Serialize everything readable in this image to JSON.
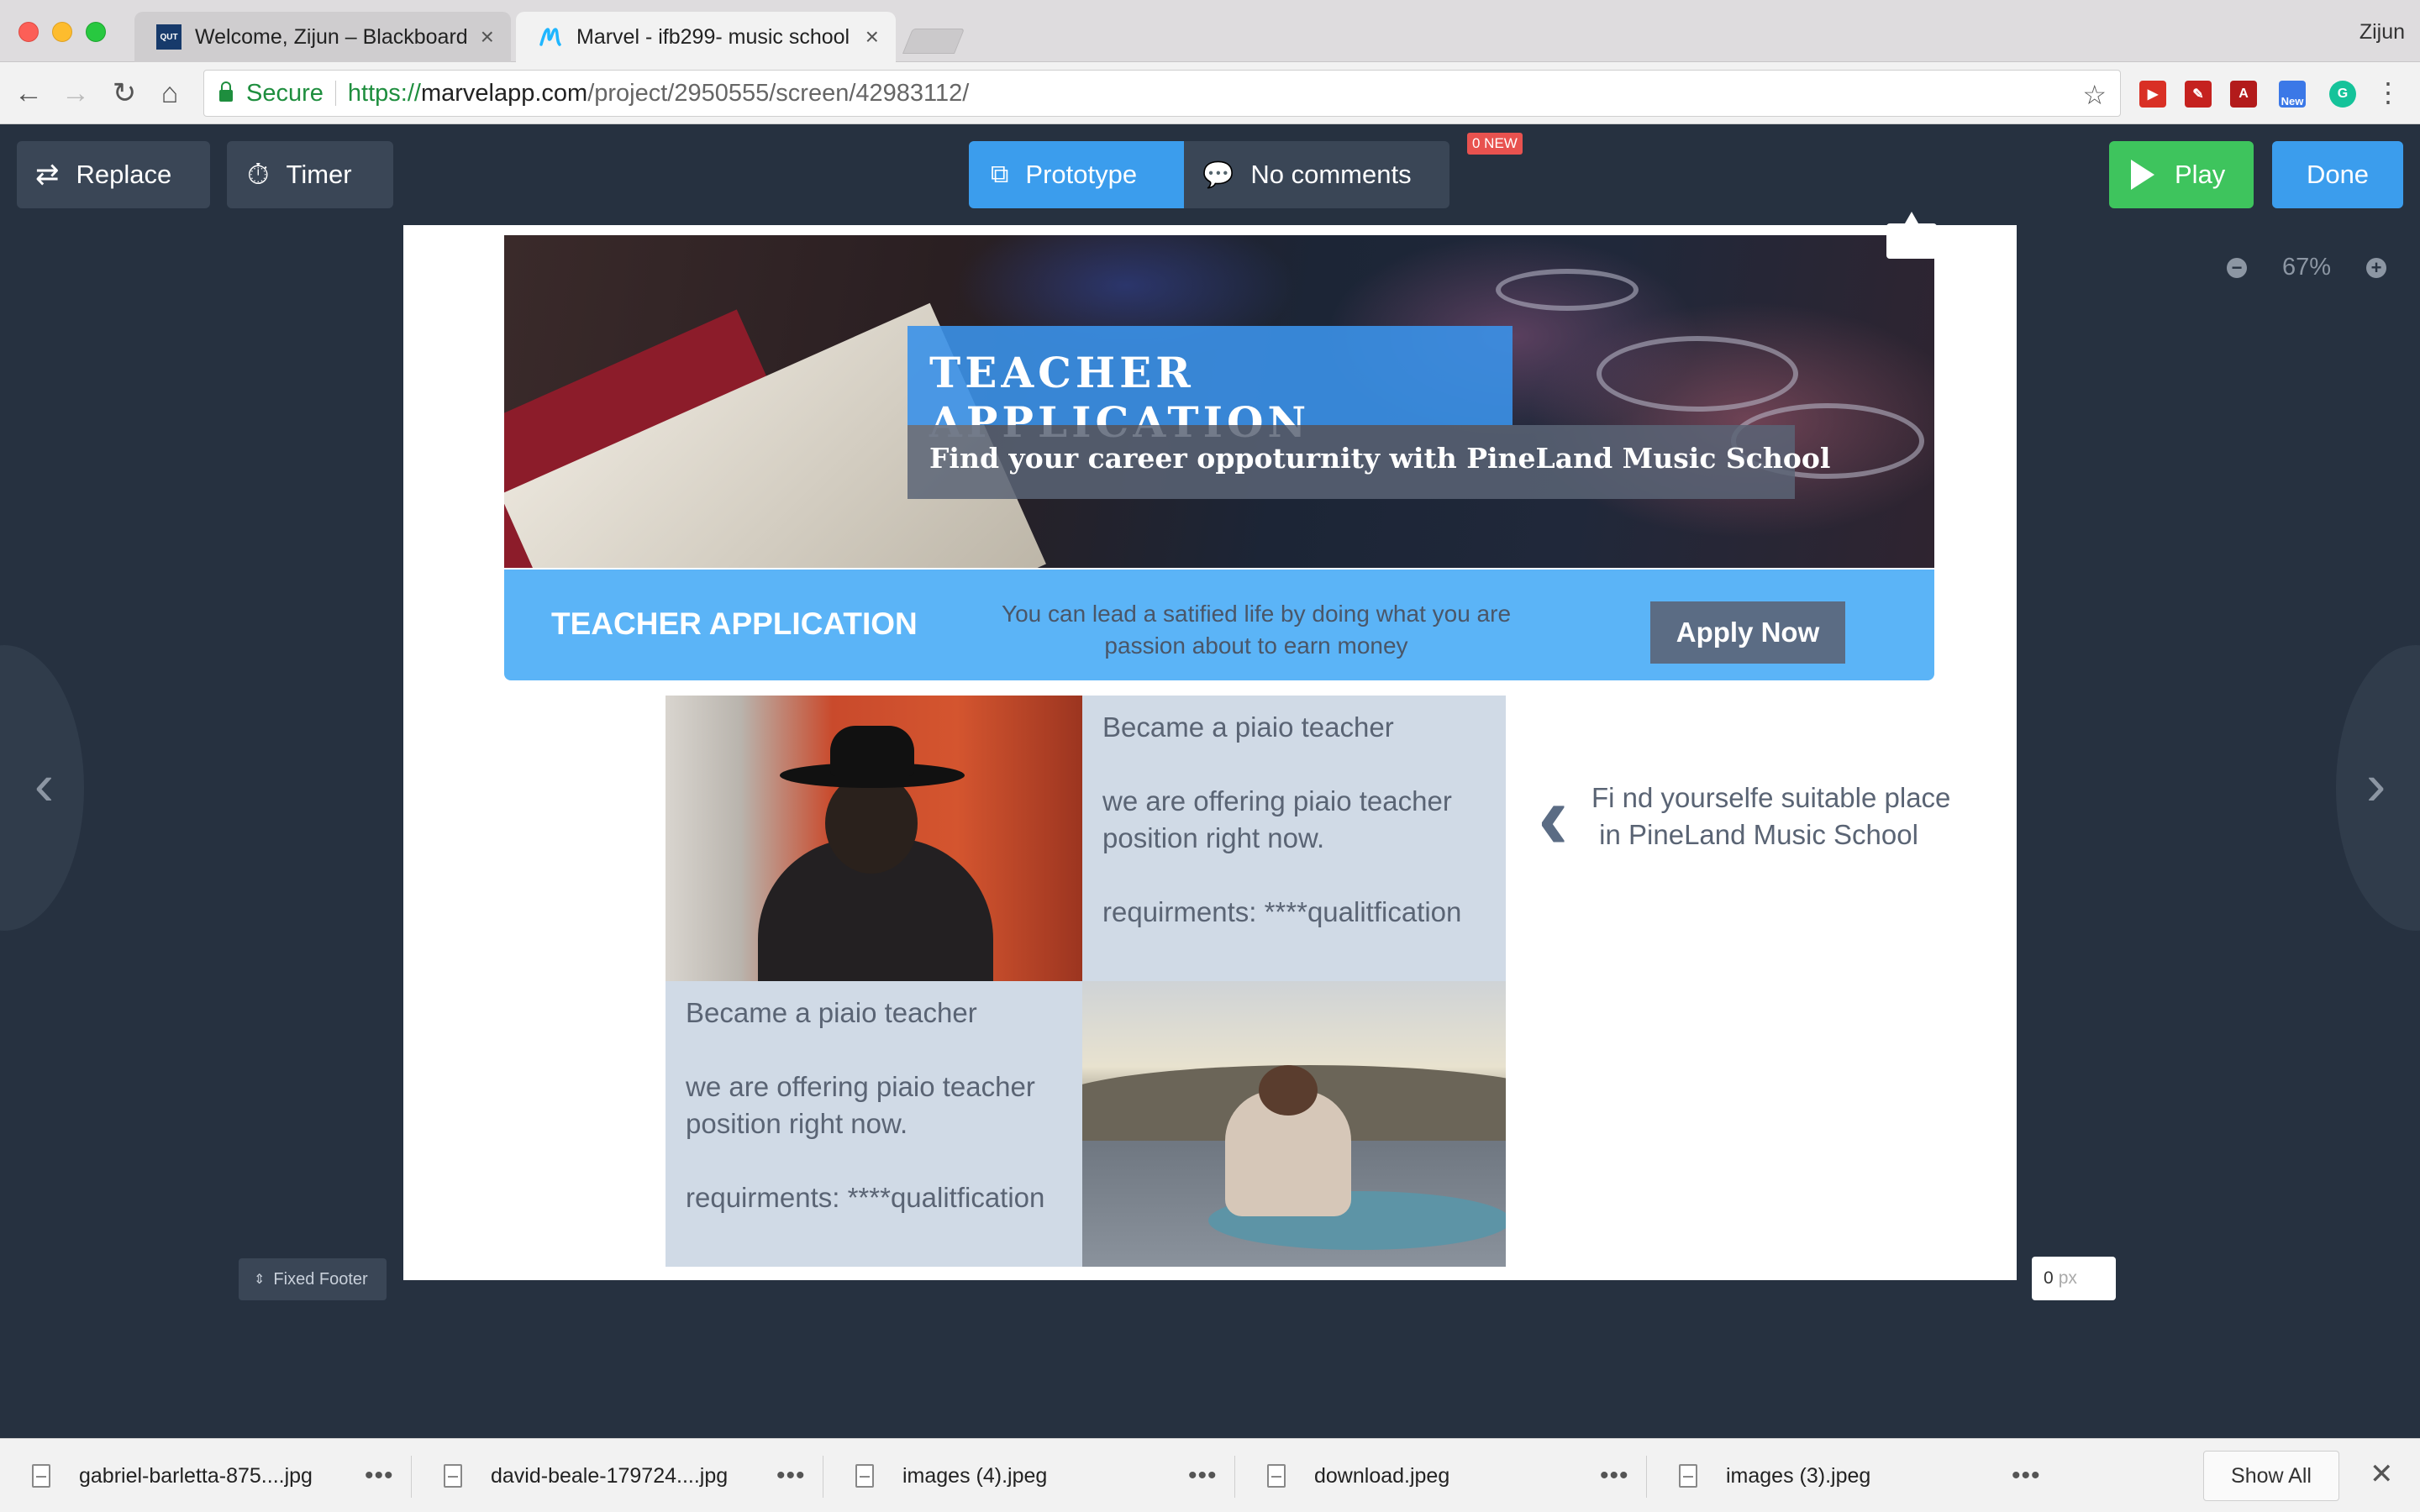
{
  "browser": {
    "tabs": [
      {
        "title": "Welcome, Zijun – Blackboard L",
        "favicon": "QUT"
      },
      {
        "title": "Marvel - ifb299- music school",
        "favicon": "marvel-logo"
      }
    ],
    "profile": "Zijun",
    "secure_label": "Secure",
    "url": {
      "scheme": "https://",
      "host": "marvelapp.com",
      "path": "/project/2950555/screen/42983112/"
    },
    "ext_new_badge": "New"
  },
  "marvel": {
    "replace_label": "Replace",
    "timer_label": "Timer",
    "prototype_label": "Prototype",
    "comments_label": "No comments",
    "new_badge": "0 NEW",
    "play_label": "Play",
    "done_label": "Done",
    "zoom_level": "67%",
    "fixed_footer_label": "Fixed Footer",
    "footer_px_value": "0",
    "footer_px_unit": "px"
  },
  "screen": {
    "hero_title": "TEACHER APPLICATION",
    "hero_subtitle": "Find your career oppoturnity with PineLand Music School",
    "strip_title": "TEACHER APPLICATION",
    "strip_text": "You can lead a satified life by doing what you are passion about to earn money",
    "apply_button": "Apply Now",
    "card_heading": "Became a piaio teacher",
    "card_offer": "we are offering piaio teacher position right now.",
    "card_req": "requirments: ****qualitfication",
    "tip_line1": "Fi nd yourselfe suitable place",
    "tip_line2": " in PineLand Music School"
  },
  "downloads": {
    "items": [
      {
        "name": "gabriel-barletta-875....jpg"
      },
      {
        "name": "david-beale-179724....jpg"
      },
      {
        "name": "images (4).jpeg"
      },
      {
        "name": "download.jpeg"
      },
      {
        "name": "images (3).jpeg"
      }
    ],
    "show_all": "Show All"
  },
  "colors": {
    "editor_bg": "#263140",
    "accent_blue": "#3b9ded",
    "play_green": "#3ec45d",
    "strip_blue": "#5bb4f7",
    "card_bg": "#d0dae6"
  }
}
